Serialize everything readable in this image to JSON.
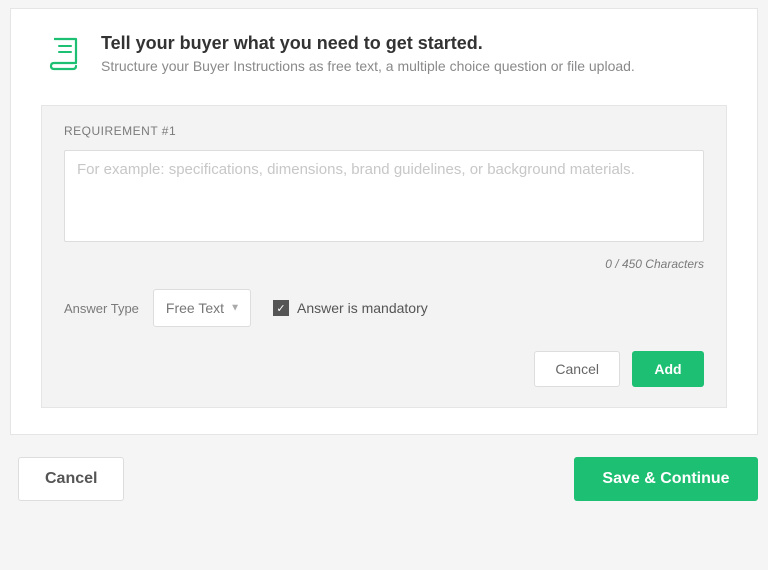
{
  "header": {
    "title": "Tell your buyer what you need to get started.",
    "subtitle": "Structure your Buyer Instructions as free text, a multiple choice question or file upload."
  },
  "requirement": {
    "label": "REQUIREMENT #1",
    "placeholder": "For example: specifications, dimensions, brand guidelines, or background materials.",
    "char_count": "0",
    "char_max_label": " / 450 Characters",
    "answer_type_label": "Answer Type",
    "answer_type_value": "Free Text",
    "mandatory_label": "Answer is mandatory",
    "cancel_label": "Cancel",
    "add_label": "Add"
  },
  "footer": {
    "cancel_label": "Cancel",
    "save_label": "Save & Continue"
  }
}
